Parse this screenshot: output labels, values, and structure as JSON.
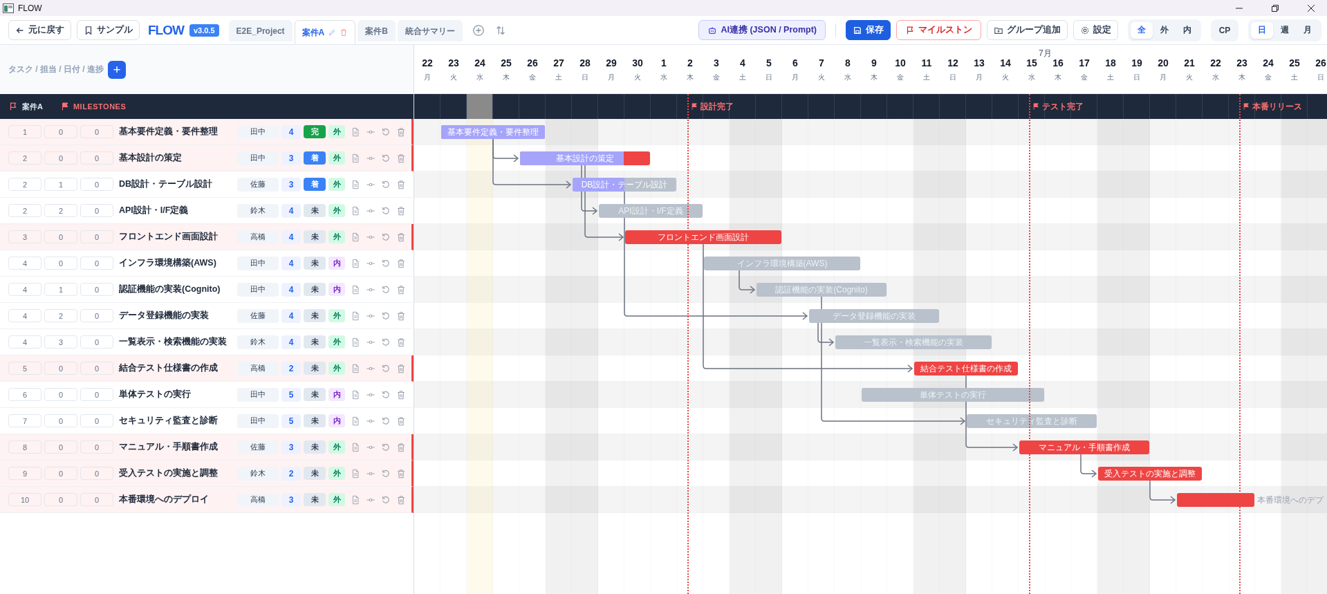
{
  "window": {
    "title": "FLOW"
  },
  "toolbar": {
    "back": "元に戻す",
    "sample": "サンプル",
    "logo": "FLOW",
    "version": "v3.0.5",
    "tabs": [
      {
        "label": "E2E_Project",
        "selected": false
      },
      {
        "label": "案件A",
        "selected": true
      },
      {
        "label": "案件B",
        "selected": false
      },
      {
        "label": "統合サマリー",
        "selected": false
      }
    ],
    "ai": "AI連携 (JSON / Prompt)",
    "save": "保存",
    "milestone": "マイルストン",
    "add_group": "グループ追加",
    "settings": "設定",
    "filters": [
      {
        "label": "全",
        "selected": true
      },
      {
        "label": "外",
        "selected": false
      },
      {
        "label": "内",
        "selected": false
      }
    ],
    "cp": "CP",
    "scales": [
      {
        "label": "日",
        "selected": true
      },
      {
        "label": "週",
        "selected": false
      },
      {
        "label": "月",
        "selected": false
      }
    ]
  },
  "task_header": {
    "label": "タスク / 担当 / 日付 / 進捗",
    "add": "+"
  },
  "group": {
    "name": "案件A",
    "milestones_label": "MILESTONES"
  },
  "timeline": {
    "days": [
      {
        "day": "22",
        "weekday": "月",
        "weekend": false,
        "today": false
      },
      {
        "day": "23",
        "weekday": "火",
        "weekend": false,
        "today": false
      },
      {
        "day": "24",
        "weekday": "水",
        "weekend": false,
        "today": true
      },
      {
        "day": "25",
        "weekday": "木",
        "weekend": false,
        "today": false
      },
      {
        "day": "26",
        "weekday": "金",
        "weekend": false,
        "today": false
      },
      {
        "day": "27",
        "weekday": "土",
        "weekend": true,
        "today": false
      },
      {
        "day": "28",
        "weekday": "日",
        "weekend": true,
        "today": false
      },
      {
        "day": "29",
        "weekday": "月",
        "weekend": false,
        "today": false
      },
      {
        "day": "30",
        "weekday": "火",
        "weekend": false,
        "today": false
      },
      {
        "day": "1",
        "weekday": "水",
        "weekend": false,
        "today": false
      },
      {
        "day": "2",
        "weekday": "木",
        "weekend": false,
        "today": false
      },
      {
        "day": "3",
        "weekday": "金",
        "weekend": false,
        "today": false
      },
      {
        "day": "4",
        "weekday": "土",
        "weekend": true,
        "today": false
      },
      {
        "day": "5",
        "weekday": "日",
        "weekend": true,
        "today": false
      },
      {
        "day": "6",
        "weekday": "月",
        "weekend": false,
        "today": false
      },
      {
        "day": "7",
        "weekday": "火",
        "weekend": false,
        "today": false
      },
      {
        "day": "8",
        "weekday": "水",
        "weekend": false,
        "today": false
      },
      {
        "day": "9",
        "weekday": "木",
        "weekend": false,
        "today": false
      },
      {
        "day": "10",
        "weekday": "金",
        "weekend": false,
        "today": false
      },
      {
        "day": "11",
        "weekday": "土",
        "weekend": true,
        "today": false
      },
      {
        "day": "12",
        "weekday": "日",
        "weekend": true,
        "today": false
      },
      {
        "day": "13",
        "weekday": "月",
        "weekend": false,
        "today": false
      },
      {
        "day": "14",
        "weekday": "火",
        "weekend": false,
        "today": false
      },
      {
        "day": "15",
        "weekday": "水",
        "weekend": false,
        "today": false
      },
      {
        "day": "16",
        "weekday": "木",
        "weekend": false,
        "today": false,
        "month": "7月"
      },
      {
        "day": "17",
        "weekday": "金",
        "weekend": false,
        "today": false
      },
      {
        "day": "18",
        "weekday": "土",
        "weekend": true,
        "today": false
      },
      {
        "day": "19",
        "weekday": "日",
        "weekend": true,
        "today": false
      },
      {
        "day": "20",
        "weekday": "月",
        "weekend": false,
        "today": false
      },
      {
        "day": "21",
        "weekday": "火",
        "weekend": false,
        "today": false
      },
      {
        "day": "22",
        "weekday": "水",
        "weekend": false,
        "today": false
      },
      {
        "day": "23",
        "weekday": "木",
        "weekend": false,
        "today": false
      },
      {
        "day": "24",
        "weekday": "金",
        "weekend": false,
        "today": false
      },
      {
        "day": "25",
        "weekday": "土",
        "weekend": true,
        "today": false
      },
      {
        "day": "26",
        "weekday": "日",
        "weekend": true,
        "today": false
      }
    ]
  },
  "milestones": [
    {
      "label": "設計完了"
    },
    {
      "label": "テスト完了"
    },
    {
      "label": "本番リリース"
    }
  ],
  "tasks": [
    {
      "wbs": [
        "1",
        "0",
        "0"
      ],
      "name": "基本要件定義・要件整理",
      "assignee": "田中",
      "duration": "4",
      "status": {
        "label": "完",
        "kind": "done"
      },
      "scope": {
        "label": "外",
        "kind": "external"
      },
      "critical": true,
      "level": 1,
      "bar_label": "基本要件定義・要件整理"
    },
    {
      "wbs": [
        "2",
        "0",
        "0"
      ],
      "name": "基本設計の策定",
      "assignee": "田中",
      "duration": "3",
      "status": {
        "label": "着",
        "kind": "started"
      },
      "scope": {
        "label": "外",
        "kind": "external"
      },
      "critical": true,
      "level": 0.8,
      "bar_label": "基本設計の策定"
    },
    {
      "wbs": [
        "2",
        "1",
        "0"
      ],
      "name": "DB設計・テーブル設計",
      "assignee": "佐藤",
      "duration": "3",
      "status": {
        "label": "着",
        "kind": "started"
      },
      "scope": {
        "label": "外",
        "kind": "external"
      },
      "critical": false,
      "level": 0.5,
      "bar_label": "DB設計・テーブル設計"
    },
    {
      "wbs": [
        "2",
        "2",
        "0"
      ],
      "name": "API設計・I/F定義",
      "assignee": "鈴木",
      "duration": "4",
      "status": {
        "label": "未",
        "kind": "todo"
      },
      "scope": {
        "label": "外",
        "kind": "external"
      },
      "critical": false,
      "bar_label": "API設計・I/F定義"
    },
    {
      "wbs": [
        "3",
        "0",
        "0"
      ],
      "name": "フロントエンド画面設計",
      "assignee": "高橋",
      "duration": "4",
      "status": {
        "label": "未",
        "kind": "todo"
      },
      "scope": {
        "label": "外",
        "kind": "external"
      },
      "critical": true,
      "bar_label": "フロントエンド画面設計"
    },
    {
      "wbs": [
        "4",
        "0",
        "0"
      ],
      "name": "インフラ環境構築(AWS)",
      "assignee": "田中",
      "duration": "4",
      "status": {
        "label": "未",
        "kind": "todo"
      },
      "scope": {
        "label": "内",
        "kind": "internal"
      },
      "critical": false,
      "bar_label": "インフラ環境構築(AWS)"
    },
    {
      "wbs": [
        "4",
        "1",
        "0"
      ],
      "name": "認証機能の実装(Cognito)",
      "assignee": "田中",
      "duration": "4",
      "status": {
        "label": "未",
        "kind": "todo"
      },
      "scope": {
        "label": "内",
        "kind": "internal"
      },
      "critical": false,
      "bar_label": "認証機能の実装(Cognito)"
    },
    {
      "wbs": [
        "4",
        "2",
        "0"
      ],
      "name": "データ登録機能の実装",
      "assignee": "佐藤",
      "duration": "4",
      "status": {
        "label": "未",
        "kind": "todo"
      },
      "scope": {
        "label": "外",
        "kind": "external"
      },
      "critical": false,
      "bar_label": "データ登録機能の実装"
    },
    {
      "wbs": [
        "4",
        "3",
        "0"
      ],
      "name": "一覧表示・検索機能の実装",
      "assignee": "鈴木",
      "duration": "4",
      "status": {
        "label": "未",
        "kind": "todo"
      },
      "scope": {
        "label": "外",
        "kind": "external"
      },
      "critical": false,
      "bar_label": "一覧表示・検索機能の実装"
    },
    {
      "wbs": [
        "5",
        "0",
        "0"
      ],
      "name": "結合テスト仕様書の作成",
      "assignee": "高橋",
      "duration": "2",
      "status": {
        "label": "未",
        "kind": "todo"
      },
      "scope": {
        "label": "外",
        "kind": "external"
      },
      "critical": true,
      "bar_label": "結合テスト仕様書の作成"
    },
    {
      "wbs": [
        "6",
        "0",
        "0"
      ],
      "name": "単体テストの実行",
      "assignee": "田中",
      "duration": "5",
      "status": {
        "label": "未",
        "kind": "todo"
      },
      "scope": {
        "label": "内",
        "kind": "internal"
      },
      "critical": false,
      "bar_label": "単体テストの実行"
    },
    {
      "wbs": [
        "7",
        "0",
        "0"
      ],
      "name": "セキュリティ監査と診断",
      "assignee": "田中",
      "duration": "5",
      "status": {
        "label": "未",
        "kind": "todo"
      },
      "scope": {
        "label": "内",
        "kind": "internal"
      },
      "critical": false,
      "bar_label": "セキュリティ監査と診断"
    },
    {
      "wbs": [
        "8",
        "0",
        "0"
      ],
      "name": "マニュアル・手順書作成",
      "assignee": "佐藤",
      "duration": "3",
      "status": {
        "label": "未",
        "kind": "todo"
      },
      "scope": {
        "label": "外",
        "kind": "external"
      },
      "critical": true,
      "bar_label": "マニュアル・手順書作成"
    },
    {
      "wbs": [
        "9",
        "0",
        "0"
      ],
      "name": "受入テストの実施と調整",
      "assignee": "鈴木",
      "duration": "2",
      "status": {
        "label": "未",
        "kind": "todo"
      },
      "scope": {
        "label": "外",
        "kind": "external"
      },
      "critical": true,
      "bar_label": "受入テストの実施と調整"
    },
    {
      "wbs": [
        "10",
        "0",
        "0"
      ],
      "name": "本番環境へのデプロイ",
      "assignee": "高橋",
      "duration": "3",
      "status": {
        "label": "未",
        "kind": "todo"
      },
      "scope": {
        "label": "外",
        "kind": "external"
      },
      "critical": true,
      "bar_label": "本番環境へのデプ",
      "label_outside": true
    }
  ]
}
